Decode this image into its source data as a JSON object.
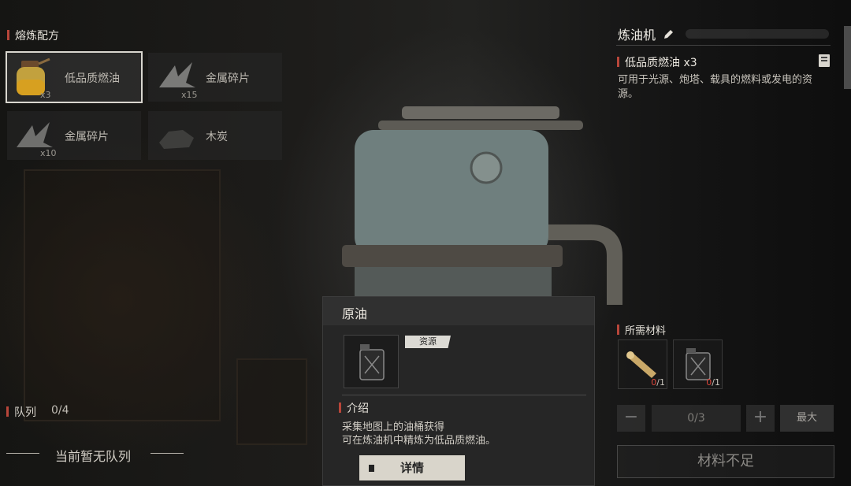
{
  "recipes_panel": {
    "title": "熔炼配方",
    "items": [
      {
        "name": "低品质燃油",
        "qty": "x3",
        "icon": "oil-jar-icon",
        "selected": true
      },
      {
        "name": "金属碎片",
        "qty": "x15",
        "icon": "metal-scrap-icon",
        "selected": false
      },
      {
        "name": "金属碎片",
        "qty": "x10",
        "icon": "metal-scrap-icon",
        "selected": false
      },
      {
        "name": "木炭",
        "qty": "",
        "icon": "charcoal-icon",
        "selected": false
      }
    ]
  },
  "queue": {
    "label": "队列",
    "count": "0/4",
    "empty_text": "当前暂无队列"
  },
  "machine": {
    "name": "炼油机",
    "product": "低品质燃油 x3",
    "description": "可用于光源、炮塔、载具的燃料或发电的资源。"
  },
  "materials": {
    "title": "所需材料",
    "items": [
      {
        "icon": "wood-log-icon",
        "have": "0",
        "need": "/1"
      },
      {
        "icon": "jerrycan-icon",
        "have": "0",
        "need": "/1"
      }
    ]
  },
  "controls": {
    "minus": "−",
    "value": "0/3",
    "plus": "+",
    "max": "最大",
    "craft": "材料不足"
  },
  "tooltip": {
    "title": "原油",
    "tag": "资源",
    "section": "介绍",
    "desc_line1": "采集地图上的油桶获得",
    "desc_line2": "可在炼油机中精炼为低品质燃油。",
    "detail": "详情"
  },
  "colors": {
    "accent": "#b8463a",
    "shortage": "#e0473c"
  }
}
